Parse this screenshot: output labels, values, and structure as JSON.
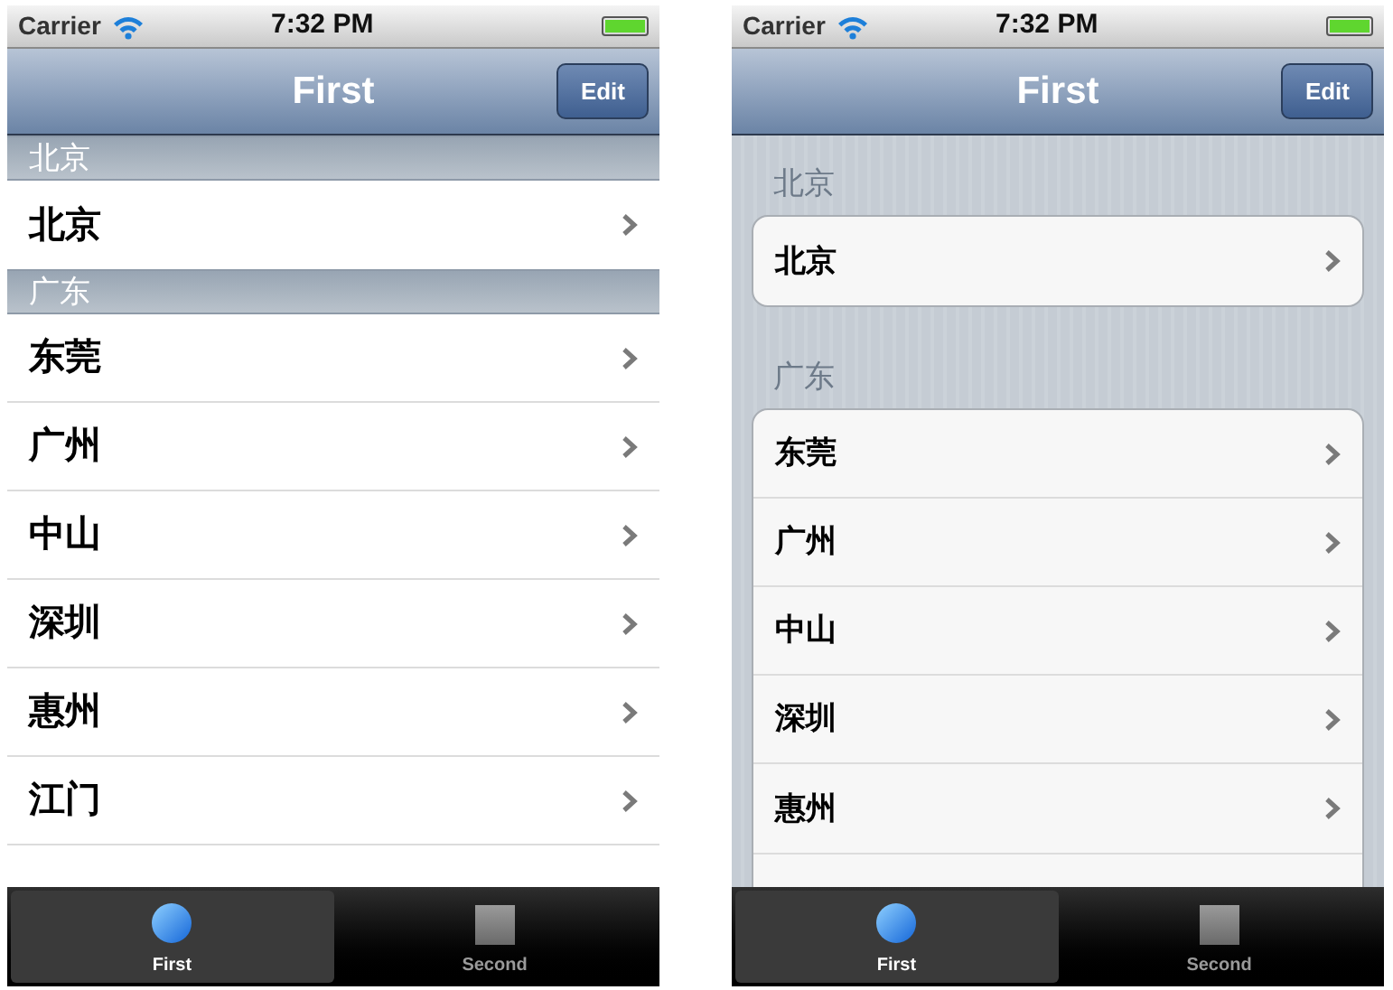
{
  "phones": [
    {
      "kind": "plain",
      "status_bar": {
        "carrier": "Carrier",
        "time": "7:32 PM"
      },
      "nav_bar": {
        "title": "First",
        "edit_button": "Edit"
      },
      "sections": [
        {
          "header": "北京",
          "rows": [
            "北京"
          ]
        },
        {
          "header": "广东",
          "rows": [
            "东莞",
            "广州",
            "中山",
            "深圳",
            "惠州",
            "江门"
          ]
        }
      ],
      "tabs": [
        {
          "label": "First",
          "selected": true,
          "kind": "circle"
        },
        {
          "label": "Second",
          "selected": false,
          "kind": "square"
        }
      ]
    },
    {
      "kind": "grouped",
      "status_bar": {
        "carrier": "Carrier",
        "time": "7:32 PM"
      },
      "nav_bar": {
        "title": "First",
        "edit_button": "Edit"
      },
      "sections": [
        {
          "header": "北京",
          "rows": [
            "北京"
          ]
        },
        {
          "header": "广东",
          "rows": [
            "东莞",
            "广州",
            "中山",
            "深圳",
            "惠州"
          ]
        }
      ],
      "tabs": [
        {
          "label": "First",
          "selected": true,
          "kind": "circle"
        },
        {
          "label": "Second",
          "selected": false,
          "kind": "square"
        }
      ]
    }
  ]
}
